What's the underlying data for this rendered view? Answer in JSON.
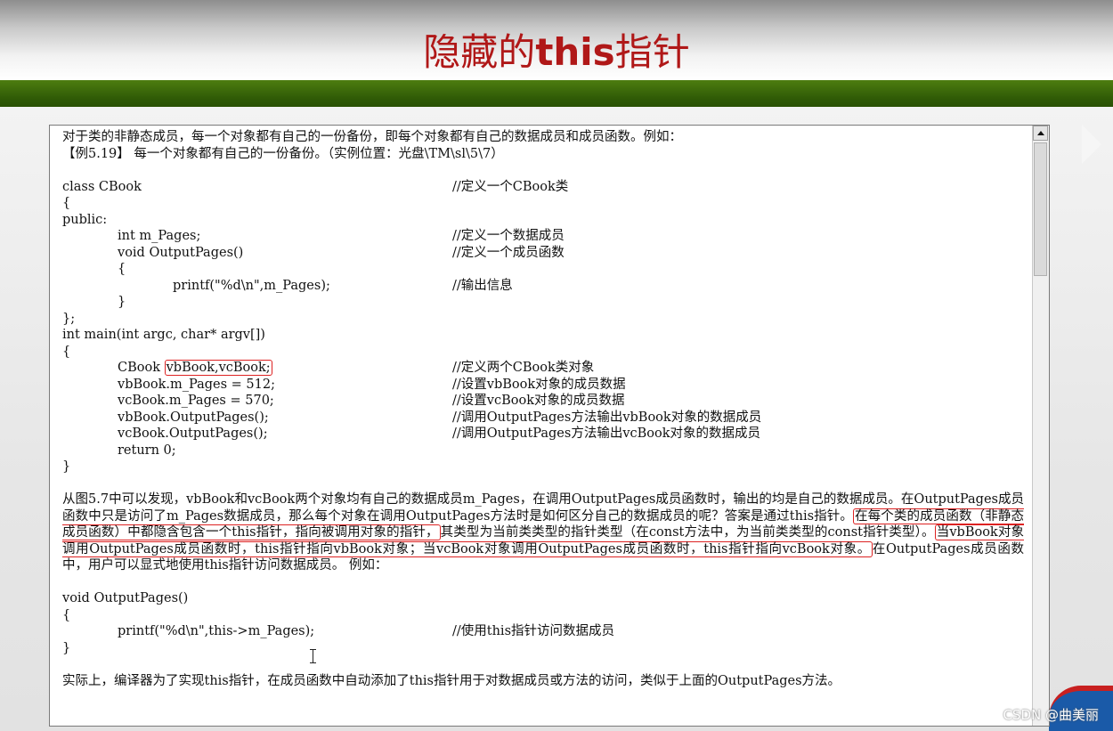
{
  "slide": {
    "title_pre": "隐藏的",
    "title_bold": "this",
    "title_post": "指针"
  },
  "doc": {
    "intro": "对于类的非静态成员，每一个对象都有自己的一份备份，即每个对象都有自己的数据成员和成员函数。例如：",
    "example_heading": "【例5.19】 每一个对象都有自己的一份备份。（实例位置：光盘\\TM\\sl\\5\\7）",
    "code1": [
      {
        "code": "class CBook",
        "comment": "//定义一个CBook类"
      },
      {
        "code": "{",
        "comment": ""
      },
      {
        "code": "public:",
        "comment": ""
      },
      {
        "code": "int m_Pages;",
        "comment": "//定义一个数据成员"
      },
      {
        "code": "void OutputPages()",
        "comment": "//定义一个成员函数"
      },
      {
        "code": "{",
        "comment": ""
      },
      {
        "code": "printf(\"%d\\n\",m_Pages);",
        "comment": "//输出信息"
      },
      {
        "code": "}",
        "comment": ""
      },
      {
        "code": "};",
        "comment": ""
      },
      {
        "code": "int main(int argc, char* argv[])",
        "comment": ""
      },
      {
        "code": "{",
        "comment": ""
      },
      {
        "code_pre": "CBook ",
        "code_box": "vbBook,vcBook;",
        "comment": "//定义两个CBook类对象"
      },
      {
        "code": "vbBook.m_Pages = 512;",
        "comment": "//设置vbBook对象的成员数据"
      },
      {
        "code": "vcBook.m_Pages = 570;",
        "comment": "//设置vcBook对象的成员数据"
      },
      {
        "code": "vbBook.OutputPages();",
        "comment": "//调用OutputPages方法输出vbBook对象的数据成员"
      },
      {
        "code": "vcBook.OutputPages();",
        "comment": "//调用OutputPages方法输出vcBook对象的数据成员"
      },
      {
        "code": "return 0;",
        "comment": ""
      },
      {
        "code": "}",
        "comment": ""
      }
    ],
    "para": {
      "p1": "从图5.7中可以发现，vbBook和vcBook两个对象均有自己的数据成员m_Pages，在调用OutputPages成员函数时，输出的均是自己的数据成员。在OutputPages成员函数中只是访问了m_Pages数据成员，那么每个对象在调用OutputPages方法时是如何区分自己的数据成员的呢？答案是通过this指针。",
      "box1": "在每个类的成员函数（非静态成员函数）中都隐含包含一个this指针，指向被调用对象的指针，",
      "p2": "其类型为当前类类型的指针类型（在const方法中，为当前类类型的const指针类型）。",
      "box2": "当vbBook对象调用OutputPages成员函数时，this指针指向vbBook对象；当vcBook对象调用OutputPages成员函数时，this指针指向vcBook对象。",
      "p3": "在OutputPages成员函数中，用户可以显式地使用this指针访问数据成员。",
      "p3b": "例如："
    },
    "code2": [
      {
        "code": "void OutputPages()",
        "comment": ""
      },
      {
        "code": "{",
        "comment": ""
      },
      {
        "code": "printf(\"%d\\n\",this->m_Pages);",
        "comment": "//使用this指针访问数据成员"
      },
      {
        "code": "}",
        "comment": ""
      }
    ],
    "closing": "实际上，编译器为了实现this指针，在成员函数中自动添加了this指针用于对数据成员或方法的访问，类似于上面的OutputPages方法。"
  },
  "watermark": "CSDN @曲美丽"
}
